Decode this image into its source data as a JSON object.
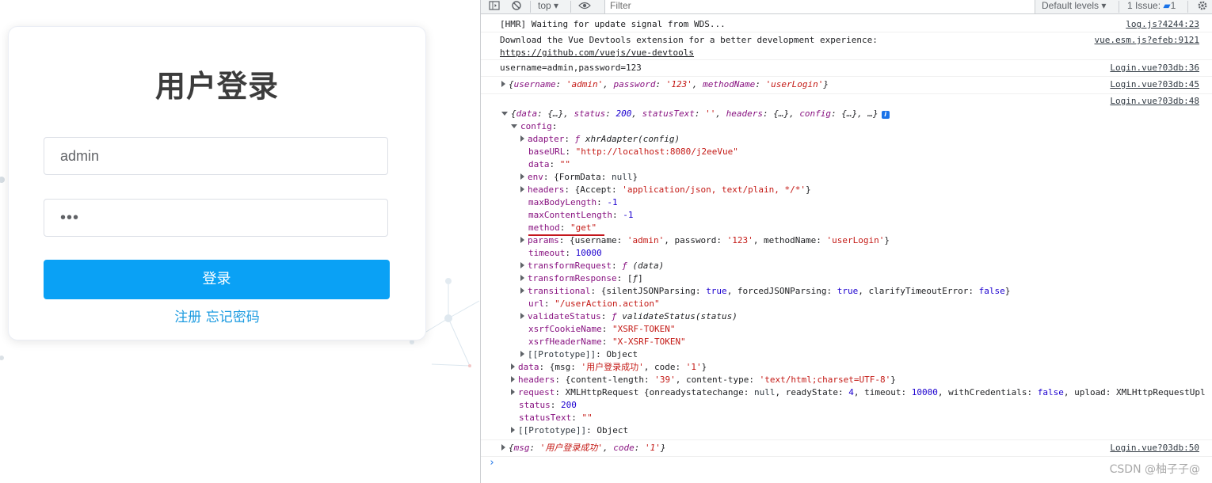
{
  "login": {
    "title": "用户登录",
    "username_value": "admin",
    "password_mask": "•••",
    "login_button": "登录",
    "register_link": "注册",
    "forgot_link": "忘记密码"
  },
  "devtools": {
    "toolbar": {
      "context": "top",
      "filter_placeholder": "Filter",
      "levels": "Default levels",
      "issues": "1 Issue:",
      "issues_count": "1"
    },
    "messages": {
      "hmr": "[HMR] Waiting for update signal from WDS...",
      "hmr_src": "log.js?4244:23",
      "devtools_msg": "Download the Vue Devtools extension for a better development experience:",
      "devtools_link": "https://github.com/vuejs/vue-devtools",
      "devtools_src": "vue.esm.js?efeb:9121",
      "creds": "username=admin,password=123",
      "creds_src": "Login.vue?03db:36",
      "params_src": "Login.vue?03db:45",
      "response_src": "Login.vue?03db:48",
      "final_src": "Login.vue?03db:50"
    },
    "watermark": "CSDN @柚子子@"
  }
}
